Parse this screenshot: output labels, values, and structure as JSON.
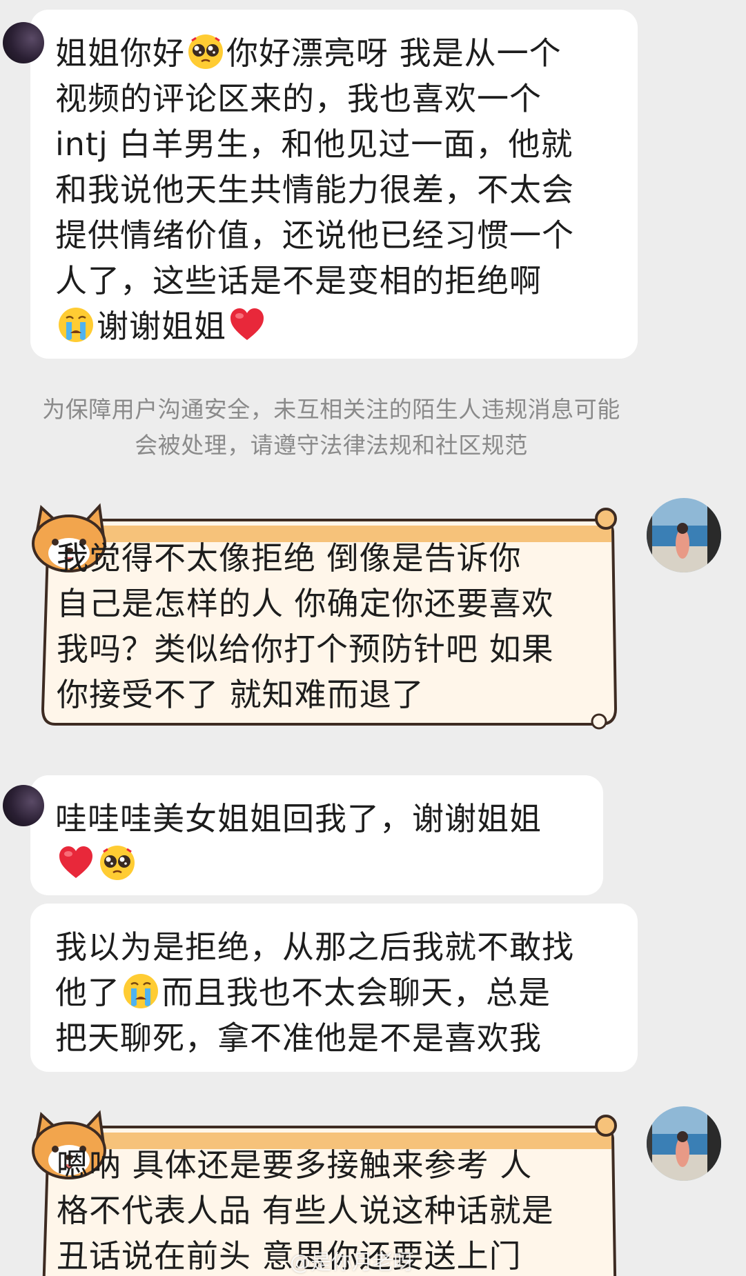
{
  "messages": [
    {
      "id": "m1",
      "side": "left",
      "segments": [
        {
          "type": "text",
          "value": "姐姐你好"
        },
        {
          "type": "emoji",
          "name": "pleading-face-icon"
        },
        {
          "type": "text",
          "value": "你好漂亮呀 我是从一个\n视频的评论区来的，我也喜欢一个\nintj 白羊男生，和他见过一面，他就\n和我说他天生共情能力很差，不太会\n提供情绪价值，还说他已经习惯一个\n人了，这些话是不是变相的拒绝啊\n"
        },
        {
          "type": "emoji",
          "name": "crying-face-icon"
        },
        {
          "type": "text",
          "value": "谢谢姐姐"
        },
        {
          "type": "emoji",
          "name": "red-heart-icon"
        }
      ]
    },
    {
      "id": "m2",
      "side": "right",
      "segments": [
        {
          "type": "text",
          "value": "我觉得不太像拒绝 倒像是告诉你\n自己是怎样的人 你确定你还要喜欢\n我吗？类似给你打个预防针吧 如果\n你接受不了 就知难而退了"
        }
      ]
    },
    {
      "id": "m3",
      "side": "left",
      "segments": [
        {
          "type": "text",
          "value": "哇哇哇美女姐姐回我了，谢谢姐姐\n"
        },
        {
          "type": "emoji",
          "name": "red-heart-icon"
        },
        {
          "type": "emoji",
          "name": "pleading-face-icon"
        }
      ]
    },
    {
      "id": "m4",
      "side": "left",
      "segments": [
        {
          "type": "text",
          "value": "我以为是拒绝，从那之后我就不敢找\n他了"
        },
        {
          "type": "emoji",
          "name": "crying-face-icon"
        },
        {
          "type": "text",
          "value": "而且我也不太会聊天，总是\n把天聊死，拿不准他是不是喜欢我"
        }
      ]
    },
    {
      "id": "m5",
      "side": "right",
      "segments": [
        {
          "type": "text",
          "value": "嗯呐 具体还是要多接触来参考 人\n格不代表人品 有些人说这种话就是\n丑话说在前头 意思你还要送上门"
        }
      ]
    }
  ],
  "notice": {
    "line1": "为保障用户沟通安全，未互相关注的陌生人违规消息可能",
    "line2": "会被处理，请遵守法律法规和社区规范"
  },
  "watermark": "@是你月老呀"
}
